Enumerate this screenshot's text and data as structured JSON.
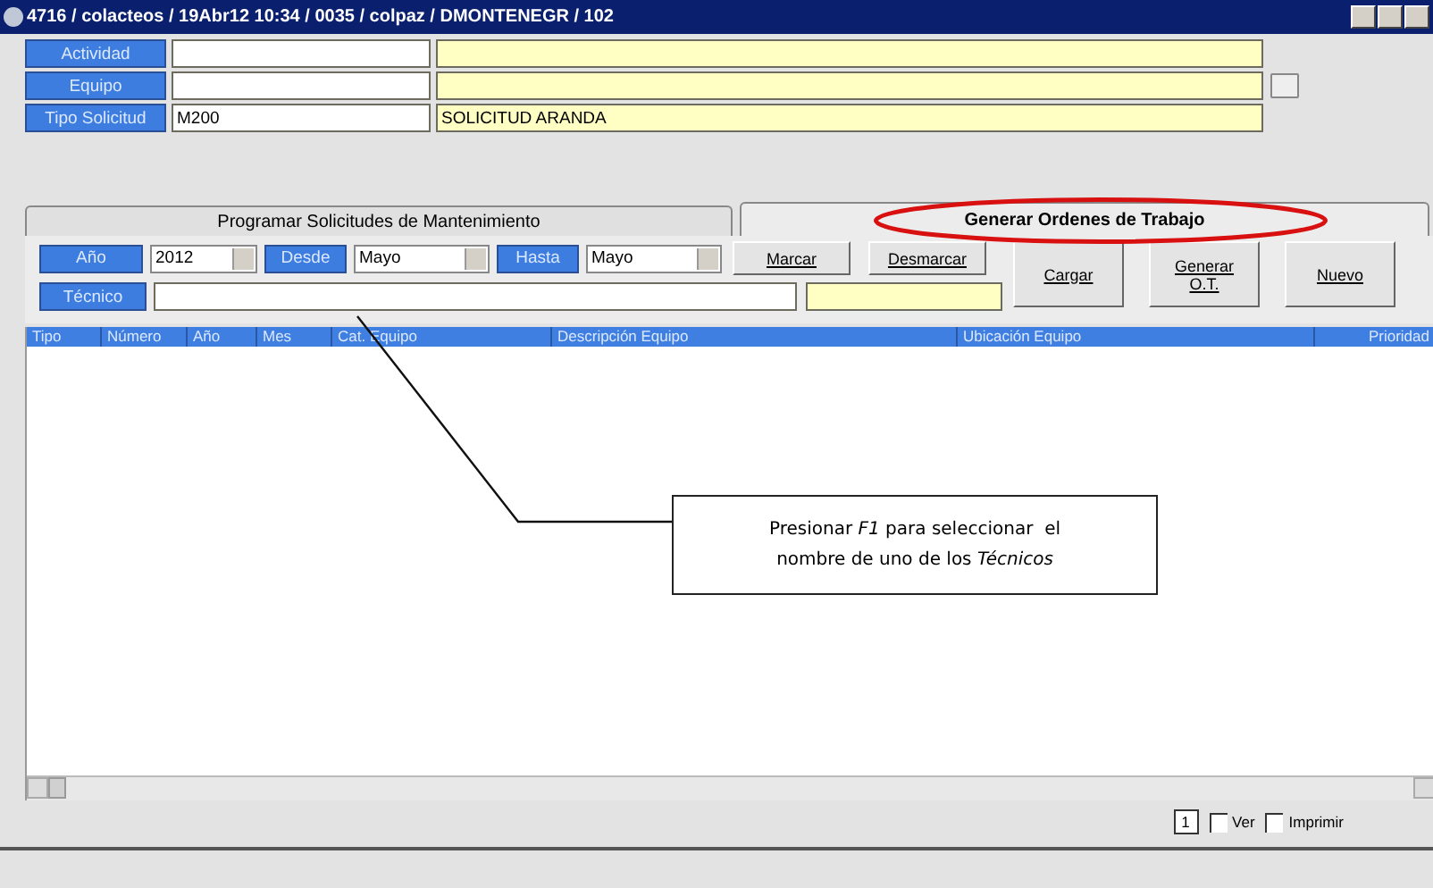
{
  "window": {
    "title": "4716 / colacteos / 19Abr12 10:34 / 0035 / colpaz / DMONTENEGR / 102"
  },
  "header_fields": [
    {
      "label": "Actividad"
    },
    {
      "label": "Equipo",
      "browse": true
    },
    {
      "label": "Tipo Solicitud",
      "code": "M200",
      "description": "SOLICITUD ARANDA"
    }
  ],
  "tabs": [
    {
      "label": "Programar Solicitudes de Mantenimiento",
      "selected": false,
      "highlighted": false
    },
    {
      "label": "Generar Ordenes de Trabajo",
      "selected": true,
      "highlighted": true
    }
  ],
  "filters": {
    "year": {
      "label": "Año",
      "value": "2012"
    },
    "from": {
      "label": "Desde",
      "value": "Mayo"
    },
    "to": {
      "label": "Hasta",
      "value": "Mayo"
    },
    "technician": {
      "label": "Técnico"
    }
  },
  "buttons": [
    {
      "label": "Marcar",
      "kind": "small"
    },
    {
      "label": "Desmarcar",
      "kind": "small"
    },
    {
      "label": "Cargar",
      "kind": "large"
    },
    {
      "label": "Generar\nO.T.",
      "kind": "large"
    },
    {
      "label": "Nuevo",
      "kind": "large"
    }
  ],
  "table": {
    "columns": [
      "Tipo",
      "Número",
      "Año",
      "Mes",
      "Cat. Equipo",
      "Descripción Equipo",
      "Ubicación Equipo",
      "Prioridad"
    ]
  },
  "callout": {
    "text": "Presionar *F1* para seleccionar  el nombre de uno de los *Técnicos*"
  },
  "footer": {
    "page": "1",
    "options": [
      {
        "label": "Ver",
        "checked": false
      },
      {
        "label": "Imprimir",
        "checked": false
      }
    ]
  }
}
